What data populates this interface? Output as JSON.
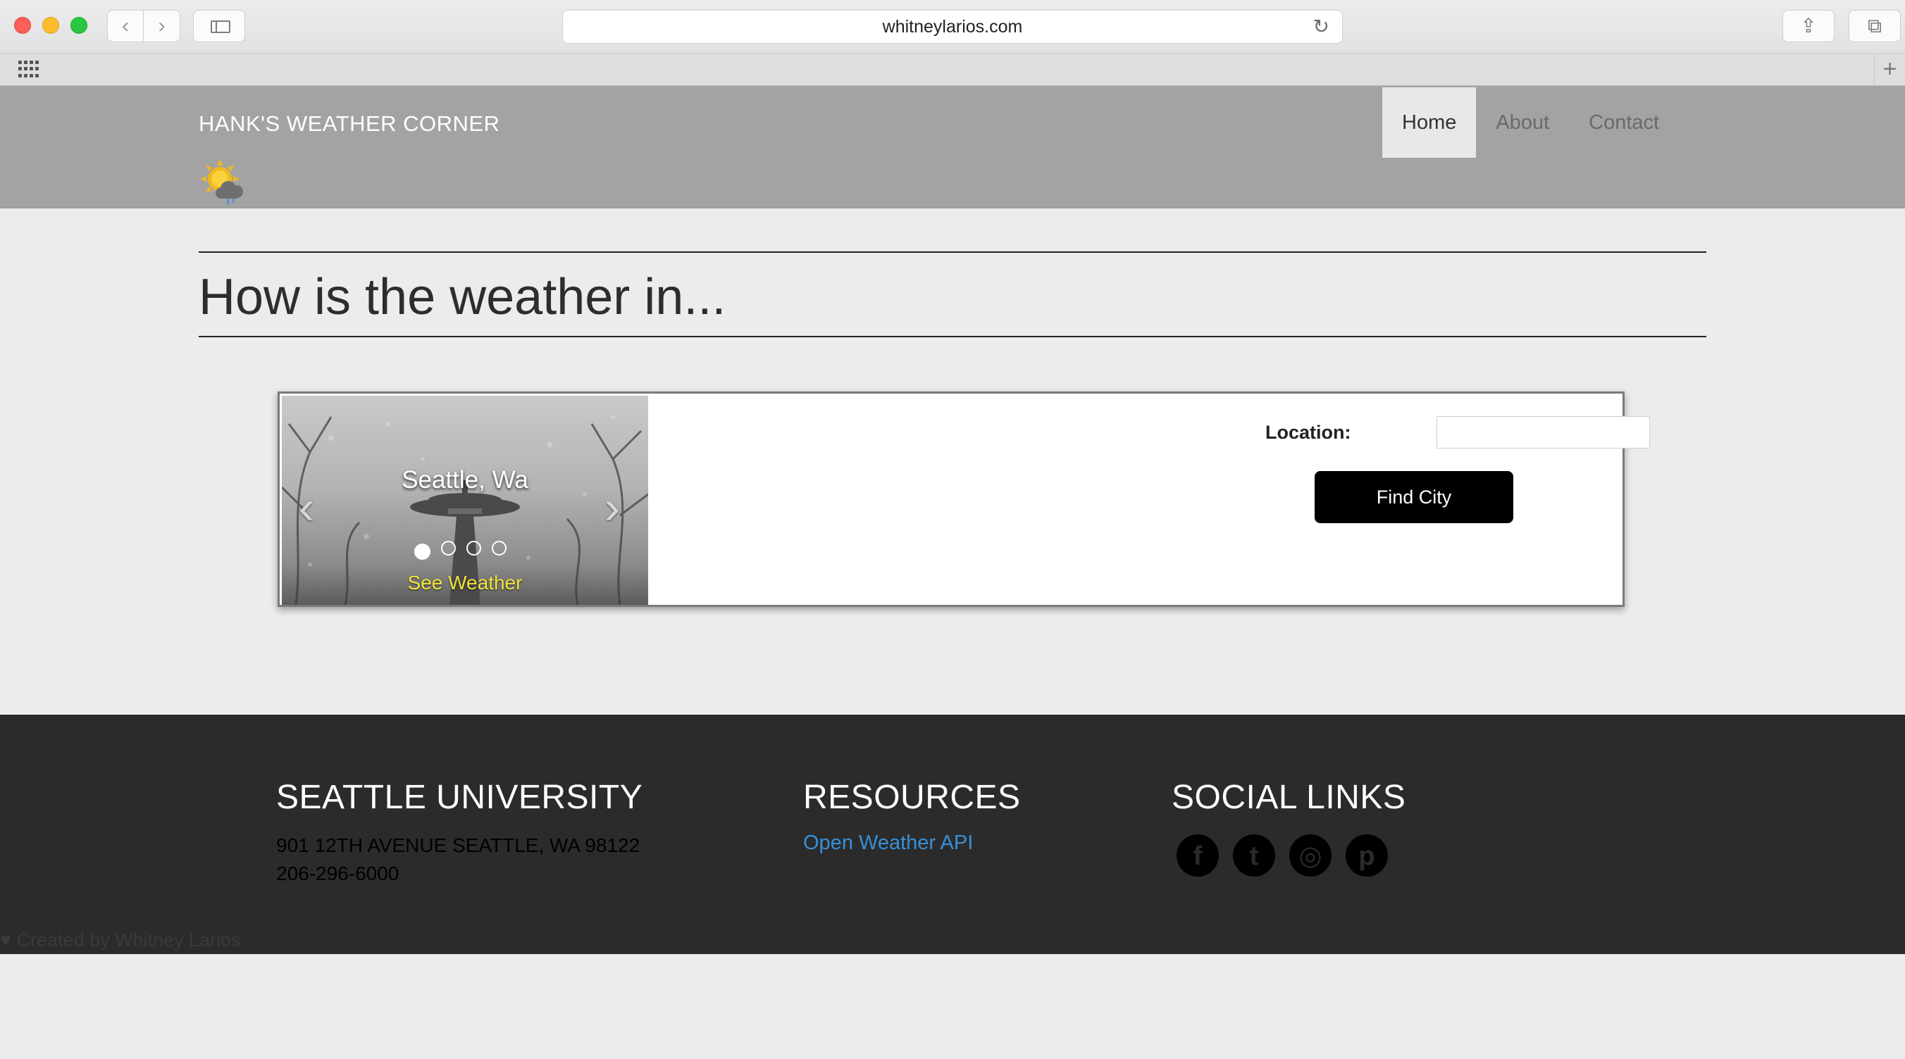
{
  "browser": {
    "url": "whitneylarios.com"
  },
  "header": {
    "brand": "HANK'S WEATHER CORNER",
    "nav": [
      {
        "label": "Home",
        "active": true
      },
      {
        "label": "About",
        "active": false
      },
      {
        "label": "Contact",
        "active": false
      }
    ]
  },
  "main": {
    "headline": "How is the weather in...",
    "carousel": {
      "slide_title": "Seattle, Wa",
      "link_label": "See Weather",
      "slide_count": 4,
      "active_slide": 0
    },
    "form": {
      "location_label": "Location:",
      "location_value": "",
      "button_label": "Find City"
    }
  },
  "footer": {
    "col1": {
      "heading": "SEATTLE UNIVERSITY",
      "address_line1": "901 12TH AVENUE SEATTLE, WA 98122",
      "phone": "206-296-6000"
    },
    "col2": {
      "heading": "RESOURCES",
      "link": "Open Weather API"
    },
    "col3": {
      "heading": "SOCIAL LINKS",
      "icons": [
        "facebook-icon",
        "twitter-icon",
        "instagram-icon",
        "pinterest-icon"
      ]
    },
    "credit": "Created by Whitney Larios"
  },
  "colors": {
    "header_bg": "#a3a3a3",
    "footer_bg": "#2b2b2b",
    "link_blue": "#3a8fd8",
    "carousel_link_yellow": "#f2e53a"
  }
}
